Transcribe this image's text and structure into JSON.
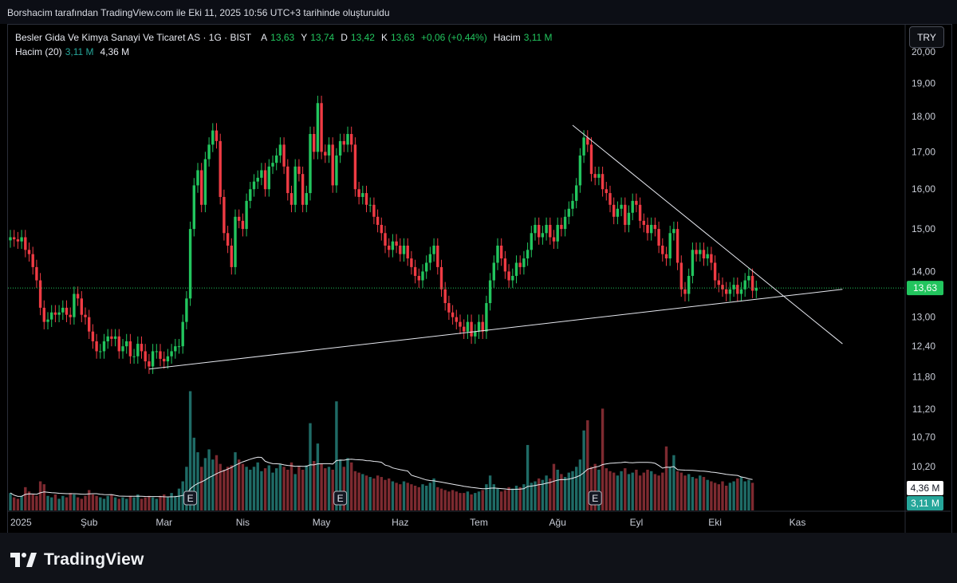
{
  "header": {
    "caption": "Borshacim tarafından TradingView.com ile Eki 11, 2025 10:56 UTC+3 tarihinde oluşturuldu"
  },
  "legend": {
    "title": "Besler Gida Ve Kimya Sanayi Ve Ticaret AS · 1G · BIST",
    "open_label": "A",
    "open": "13,63",
    "high_label": "Y",
    "high": "13,74",
    "low_label": "D",
    "low": "13,42",
    "close_label": "K",
    "close": "13,63",
    "change": "+0,06 (+0,44%)",
    "volume_label": "Hacim",
    "volume": "3,11 M",
    "ma_label": "Hacim (20)",
    "ma_volume": "3,11 M",
    "ma_value": "4,36 M"
  },
  "currency_button": "TRY",
  "brand": {
    "name": "TradingView"
  },
  "colors": {
    "up": "#22c55e",
    "down": "#ef3b44",
    "vol_up": "#1f6b66",
    "vol_down": "#7d2a30",
    "background": "#000000"
  },
  "chart_data": {
    "type": "candlestick",
    "y_scale": "log",
    "ylim": [
      9.5,
      20.6
    ],
    "y_ticks": [
      "20,00",
      "19,00",
      "18,00",
      "17,00",
      "16,00",
      "15,00",
      "14,00",
      "13,00",
      "12,40",
      "11,80",
      "11,20",
      "10,70",
      "10,20"
    ],
    "y_tick_values": [
      20.0,
      19.0,
      18.0,
      17.0,
      16.0,
      15.0,
      14.0,
      13.0,
      12.4,
      11.8,
      11.2,
      10.7,
      10.2
    ],
    "x_ticks": [
      "2025",
      "Şub",
      "Mar",
      "Nis",
      "May",
      "Haz",
      "Tem",
      "Ağu",
      "Eyl",
      "Eki",
      "Kas"
    ],
    "x_tick_positions": [
      0,
      21,
      41,
      62,
      83,
      104,
      125,
      146,
      167,
      188,
      210
    ],
    "last_price": "13,63",
    "last_price_value": 13.63,
    "volume_badges": [
      "4,36 M",
      "3,11 M"
    ],
    "earnings_markers": [
      "E",
      "E",
      "E"
    ],
    "earnings_marker_bars": [
      48,
      88,
      156
    ],
    "trendlines": [
      {
        "name": "support",
        "from": [
          37,
          11.95
        ],
        "to": [
          222,
          13.6
        ]
      },
      {
        "name": "resistance",
        "from": [
          150,
          17.75
        ],
        "to": [
          222,
          12.45
        ]
      }
    ],
    "closes": [
      14.8,
      14.75,
      14.7,
      14.8,
      14.5,
      14.4,
      14.1,
      13.8,
      13.2,
      12.9,
      12.95,
      13.1,
      13.05,
      13.1,
      13.2,
      13.05,
      13.0,
      13.5,
      13.4,
      13.05,
      13.0,
      12.7,
      12.5,
      12.3,
      12.3,
      12.5,
      12.6,
      12.55,
      12.6,
      12.3,
      12.4,
      12.5,
      12.2,
      12.2,
      12.45,
      12.3,
      12.1,
      12.0,
      12.3,
      12.3,
      12.15,
      12.1,
      12.2,
      12.3,
      12.4,
      12.4,
      12.9,
      13.4,
      15.0,
      16.1,
      16.5,
      15.6,
      16.8,
      17.2,
      17.6,
      17.3,
      15.8,
      14.9,
      14.6,
      14.1,
      15.3,
      15.2,
      15.0,
      15.7,
      16.0,
      16.2,
      16.3,
      16.5,
      16.0,
      16.6,
      16.7,
      16.9,
      17.2,
      16.6,
      15.9,
      15.6,
      16.6,
      16.4,
      15.6,
      15.9,
      17.5,
      17.0,
      18.4,
      17.0,
      16.9,
      17.2,
      16.1,
      16.9,
      17.3,
      17.2,
      17.5,
      17.2,
      16.0,
      15.8,
      15.9,
      15.6,
      15.6,
      15.3,
      15.1,
      14.9,
      14.6,
      14.5,
      14.7,
      14.6,
      14.4,
      14.6,
      14.3,
      14.1,
      13.9,
      13.8,
      14.0,
      14.2,
      14.4,
      14.6,
      14.1,
      13.6,
      13.3,
      13.1,
      13.0,
      12.9,
      12.8,
      12.7,
      12.9,
      12.6,
      12.7,
      12.9,
      12.7,
      13.3,
      13.8,
      14.2,
      14.6,
      14.3,
      14.0,
      13.8,
      13.9,
      14.2,
      14.1,
      14.3,
      14.5,
      14.9,
      15.1,
      14.8,
      14.9,
      15.1,
      14.8,
      14.7,
      15.1,
      15.0,
      15.3,
      15.5,
      15.7,
      16.1,
      16.9,
      17.4,
      17.2,
      16.4,
      16.3,
      16.4,
      16.0,
      15.9,
      15.6,
      15.3,
      15.5,
      15.6,
      15.1,
      15.4,
      15.7,
      15.6,
      15.2,
      15.1,
      14.9,
      15.1,
      15.0,
      14.6,
      14.4,
      14.3,
      14.9,
      15.0,
      14.2,
      13.6,
      13.5,
      13.9,
      14.5,
      14.4,
      14.5,
      14.3,
      14.4,
      14.2,
      13.8,
      13.7,
      13.6,
      13.5,
      13.6,
      13.7,
      13.5,
      13.6,
      13.8,
      13.9,
      13.57,
      13.63
    ],
    "volumes": [
      1.2,
      0.9,
      0.8,
      1.0,
      1.6,
      1.3,
      1.1,
      1.0,
      2.0,
      1.8,
      1.0,
      0.9,
      1.1,
      0.8,
      1.0,
      0.9,
      1.2,
      1.1,
      0.9,
      0.8,
      1.0,
      1.4,
      1.1,
      1.0,
      0.9,
      0.8,
      1.0,
      1.1,
      0.9,
      0.8,
      0.9,
      0.8,
      1.0,
      0.9,
      1.1,
      0.8,
      0.9,
      1.0,
      0.9,
      0.8,
      1.0,
      1.1,
      0.9,
      1.2,
      1.0,
      1.5,
      2.0,
      3.0,
      8.2,
      5.0,
      4.0,
      3.0,
      3.6,
      4.2,
      3.5,
      3.8,
      3.2,
      2.8,
      3.0,
      3.1,
      4.0,
      3.5,
      3.2,
      3.0,
      2.8,
      3.0,
      3.3,
      2.7,
      2.9,
      3.1,
      2.6,
      2.9,
      3.2,
      3.0,
      2.8,
      3.3,
      2.5,
      3.0,
      2.8,
      3.1,
      6.0,
      3.4,
      4.6,
      3.2,
      2.9,
      3.0,
      2.8,
      7.5,
      3.5,
      3.0,
      3.6,
      3.3,
      2.7,
      2.6,
      2.5,
      2.4,
      2.3,
      2.2,
      2.4,
      2.3,
      2.1,
      2.2,
      2.0,
      1.9,
      1.8,
      2.0,
      1.9,
      1.8,
      1.7,
      1.6,
      1.8,
      1.7,
      1.9,
      2.2,
      1.6,
      1.5,
      1.4,
      1.3,
      1.4,
      1.3,
      1.2,
      1.2,
      1.3,
      1.1,
      1.2,
      1.3,
      1.4,
      1.8,
      2.4,
      1.8,
      1.5,
      1.3,
      1.4,
      1.6,
      1.5,
      1.7,
      1.6,
      1.8,
      4.5,
      1.9,
      2.0,
      2.2,
      2.1,
      2.4,
      2.2,
      3.2,
      2.8,
      2.5,
      2.3,
      2.6,
      2.7,
      3.0,
      3.5,
      5.5,
      6.2,
      3.0,
      3.2,
      2.8,
      7.0,
      2.9,
      2.7,
      2.6,
      2.4,
      2.7,
      2.9,
      2.5,
      2.6,
      2.8,
      2.4,
      2.6,
      2.8,
      2.7,
      2.5,
      2.4,
      2.6,
      4.4,
      3.0,
      3.8,
      2.7,
      2.6,
      2.4,
      2.5,
      2.3,
      2.2,
      2.4,
      2.3,
      2.1,
      2.0,
      1.9,
      1.8,
      2.0,
      1.7,
      1.9,
      2.0,
      2.2,
      2.3,
      2.0,
      2.1,
      1.9
    ]
  }
}
